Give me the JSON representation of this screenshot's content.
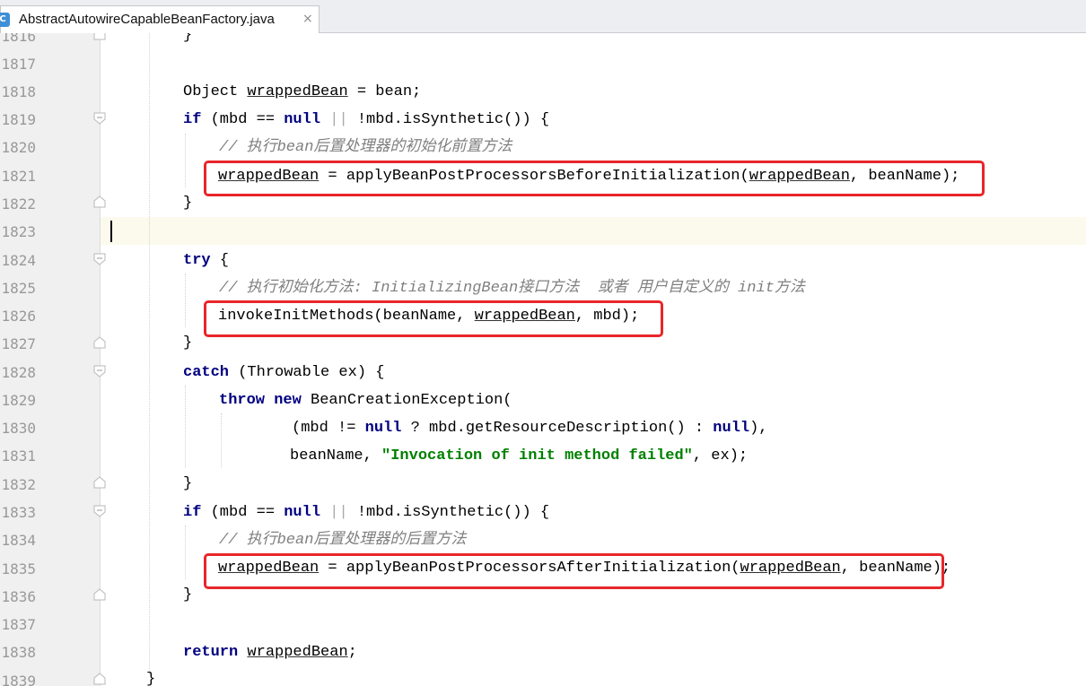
{
  "tab": {
    "file_icon": "C",
    "filename": "AbstractAutowireCapableBeanFactory.java",
    "close_glyph": "×"
  },
  "line_numbers": [
    "1816",
    "1817",
    "1818",
    "1819",
    "1820",
    "1821",
    "1822",
    "1823",
    "1824",
    "1825",
    "1826",
    "1827",
    "1828",
    "1829",
    "1830",
    "1831",
    "1832",
    "1833",
    "1834",
    "1835",
    "1836",
    "1837",
    "1838",
    "1839"
  ],
  "code": {
    "l1816_brace": "}",
    "l1818": {
      "type": "Object",
      "var": "wrappedBean",
      "rest": " = bean;"
    },
    "l1819": {
      "kw_if": "if",
      "a": " (mbd == ",
      "null": "null",
      "pipes": " || ",
      "b": "!mbd.isSynthetic()) {"
    },
    "l1820_comment": "// 执行bean后置处理器的初始化前置方法",
    "l1821": {
      "var1": "wrappedBean",
      "mid": " = applyBeanPostProcessorsBeforeInitialization(",
      "var2": "wrappedBean",
      "end": ", beanName);"
    },
    "l1822": "}",
    "l1824": {
      "kw": "try",
      "rest": " {"
    },
    "l1825_comment": "// 执行初始化方法: InitializingBean接口方法  或者 用户自定义的 init方法",
    "l1826": {
      "pre": "invokeInitMethods(beanName, ",
      "var": "wrappedBean",
      "end": ", mbd);"
    },
    "l1827": "}",
    "l1828": {
      "kw": "catch",
      "rest": " (Throwable ex) {"
    },
    "l1829": {
      "kw1": "throw",
      "kw2": "new",
      "rest": " BeanCreationException("
    },
    "l1830": {
      "a": "(mbd != ",
      "null1": "null",
      "b": " ? mbd.getResourceDescription() : ",
      "null2": "null",
      "c": "),"
    },
    "l1831": {
      "a": "beanName, ",
      "str": "\"Invocation of init method failed\"",
      "c": ", ex);"
    },
    "l1832": "}",
    "l1833": {
      "kw_if": "if",
      "a": " (mbd == ",
      "null": "null",
      "pipes": " || ",
      "b": "!mbd.isSynthetic()) {"
    },
    "l1834_comment": "// 执行bean后置处理器的后置方法",
    "l1835": {
      "var1": "wrappedBean",
      "mid": " = applyBeanPostProcessorsAfterInitialization(",
      "var2": "wrappedBean",
      "end": ", beanName);"
    },
    "l1836": "}",
    "l1838": {
      "kw": "return",
      "sp": " ",
      "var": "wrappedBean",
      "end": ";"
    },
    "l1839": "}"
  },
  "colors": {
    "keyword": "#000080",
    "string": "#008000",
    "comment": "#808080",
    "highlight_box": "#e8262a",
    "caret_line": "#fcfaed"
  }
}
